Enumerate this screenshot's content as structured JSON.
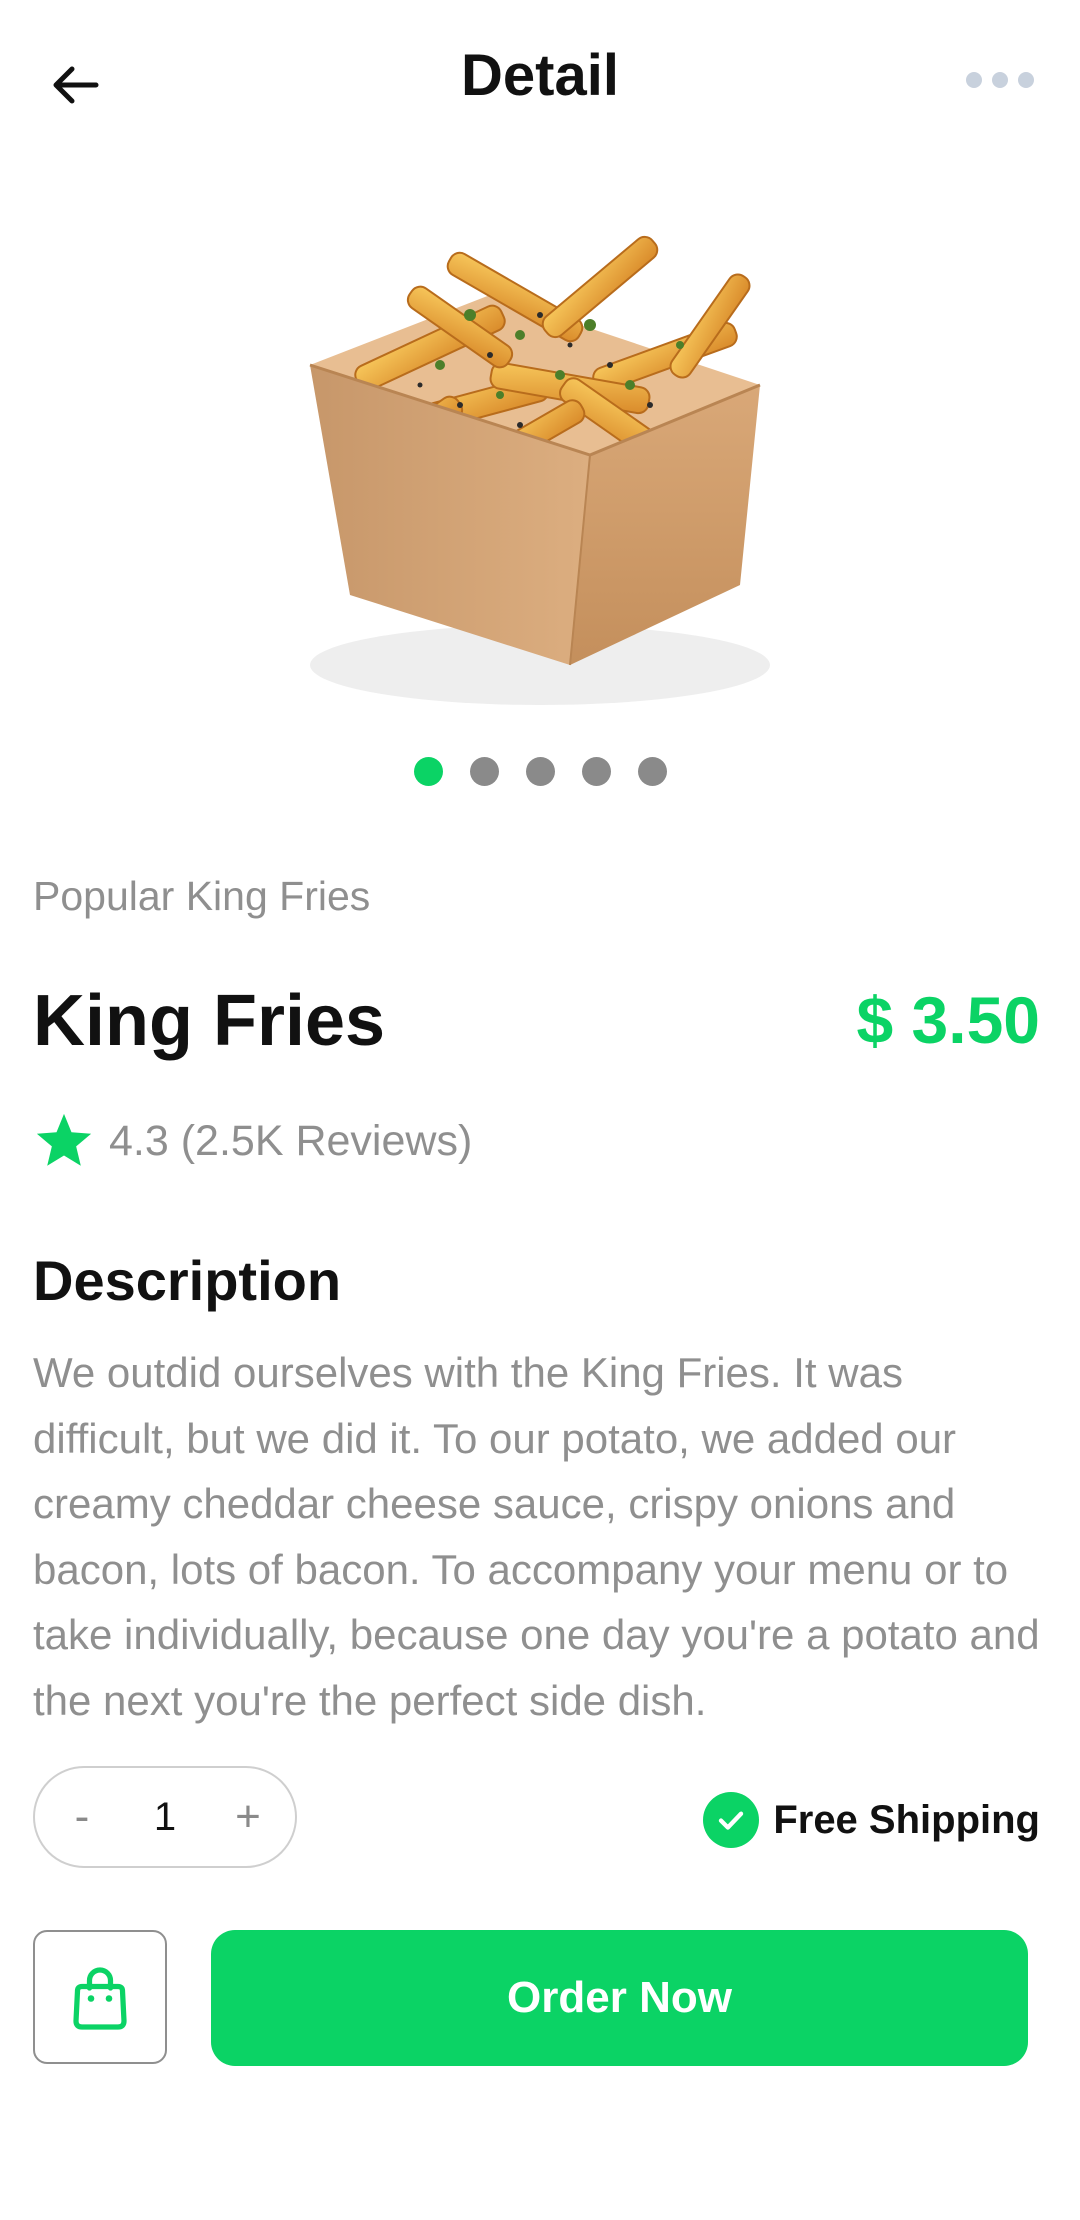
{
  "header": {
    "title": "Detail",
    "back_icon": "arrow-left-icon",
    "menu_icon": "more-horizontal-icon"
  },
  "product": {
    "image_icon": "fries-image",
    "carousel": {
      "total": 5,
      "active": 1
    },
    "category": "Popular King Fries",
    "name": "King Fries",
    "price": "$ 3.50",
    "rating": "4.3",
    "reviews": "(2.5K Reviews)",
    "description_title": "Description",
    "description": "We outdid ourselves with the King Fries. It was difficult, but we did it. To our potato, we added our creamy cheddar cheese sauce, crispy onions and bacon, lots of bacon. To accompany your menu or to take individually, because one day you're a potato and the next you're the perfect side dish."
  },
  "quantity": {
    "minus": "-",
    "value": "1",
    "plus": "+"
  },
  "shipping": {
    "label": "Free Shipping"
  },
  "actions": {
    "order_label": "Order Now",
    "cart_icon": "shopping-bag-icon"
  },
  "colors": {
    "accent": "#0bd365",
    "muted": "#8f8f8f",
    "dot": "#8a8a8a"
  }
}
